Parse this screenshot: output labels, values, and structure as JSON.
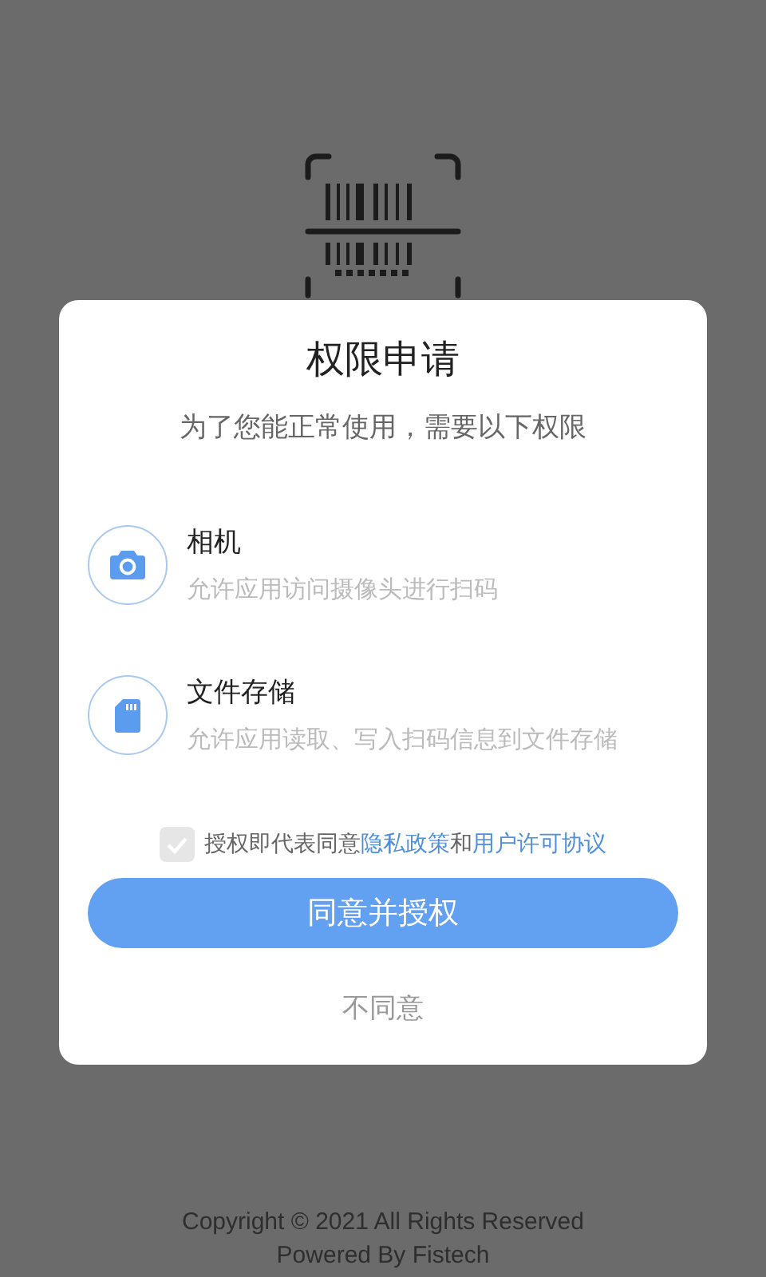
{
  "dialog": {
    "title": "权限申请",
    "subtitle": "为了您能正常使用，需要以下权限",
    "permissions": [
      {
        "kind": "camera",
        "name": "相机",
        "description": "允许应用访问摄像头进行扫码"
      },
      {
        "kind": "storage",
        "name": "文件存储",
        "description": "允许应用读取、写入扫码信息到文件存储"
      }
    ],
    "agreement": {
      "checked": true,
      "text_before": "授权即代表同意",
      "privacy_link": "隐私政策",
      "connector": "和",
      "license_link": "用户许可协议"
    },
    "confirm_button": "同意并授权",
    "decline_button": "不同意"
  },
  "footer": {
    "copyright": "Copyright © 2021 All Rights Reserved",
    "powered_by": "Powered By Fistech"
  }
}
